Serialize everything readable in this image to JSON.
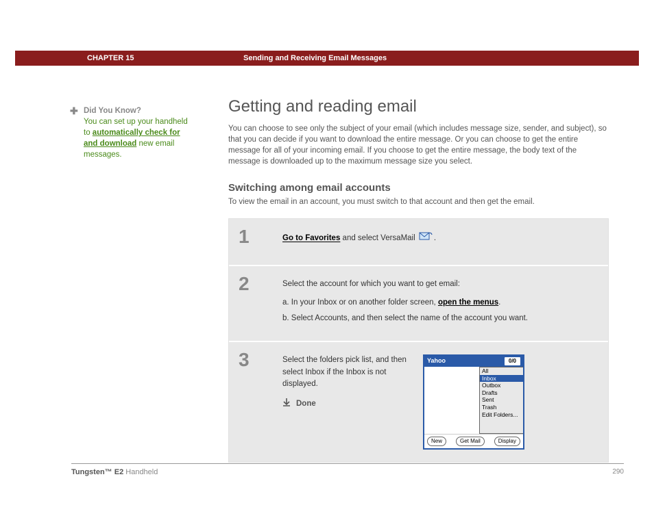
{
  "header": {
    "chapter": "CHAPTER 15",
    "title": "Sending and Receiving Email Messages"
  },
  "sidebar": {
    "dyk_title": "Did You Know?",
    "dyk_pre": "You can set up your handheld to ",
    "dyk_link": "automatically check for and download",
    "dyk_post": " new email messages."
  },
  "main": {
    "h1": "Getting and reading email",
    "intro": "You can choose to see only the subject of your email (which includes message size, sender, and subject), so that you can decide if you want to download the entire message. Or you can choose to get the entire message for all of your incoming email. If you choose to get the entire message, the body text of the message is downloaded up to the maximum message size you select.",
    "h2": "Switching among email accounts",
    "sub_intro": "To view the email in an account, you must switch to that account and then get the email."
  },
  "steps": {
    "s1": {
      "num": "1",
      "link": "Go to Favorites",
      "post": " and select VersaMail ",
      "period": "."
    },
    "s2": {
      "num": "2",
      "intro": "Select the account for which you want to get email:",
      "a_pre": "a.  In your Inbox or on another folder screen, ",
      "a_link": "open the menus",
      "a_post": ".",
      "b": "b.  Select Accounts, and then select the name of the account you want."
    },
    "s3": {
      "num": "3",
      "text": "Select the folders pick list, and then select Inbox if the Inbox is not displayed.",
      "done": "Done"
    }
  },
  "device": {
    "title": "Yahoo",
    "count": "0/0",
    "folders": {
      "all": "All",
      "inbox": "Inbox",
      "outbox": "Outbox",
      "drafts": "Drafts",
      "sent": "Sent",
      "trash": "Trash",
      "edit": "Edit Folders..."
    },
    "buttons": {
      "new": "New",
      "get": "Get Mail",
      "display": "Display"
    }
  },
  "footer": {
    "product_bold": "Tungsten™ E2",
    "product_light": " Handheld",
    "page": "290"
  }
}
